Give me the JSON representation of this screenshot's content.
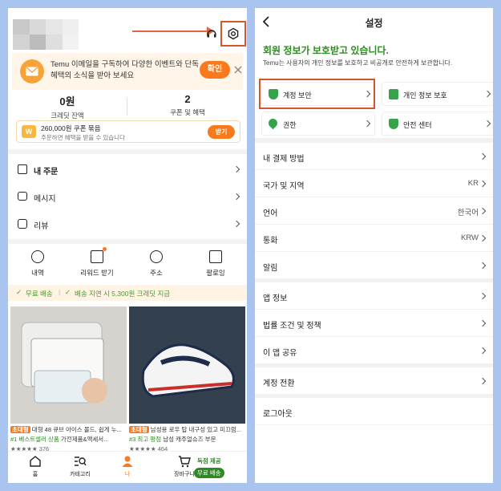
{
  "left": {
    "email_banner": {
      "text": "Temu 이메일을 구독하여 다양한 이벤트와 단독 혜택의 소식을 받아 보세요",
      "button": "확인"
    },
    "stats": [
      {
        "value": "0원",
        "label": "크레딧 잔액"
      },
      {
        "value": "2",
        "label": "쿠폰 및 혜택"
      }
    ],
    "coupon": {
      "title": "260,000원 쿠폰 묶음",
      "subtitle": "주문하면 혜택을 받을 수 있습니다",
      "button": "받기",
      "badge": "W"
    },
    "menu": [
      {
        "label": "내 주문",
        "icon": "orders-icon"
      },
      {
        "label": "메시지",
        "icon": "message-icon"
      },
      {
        "label": "리뷰",
        "icon": "review-icon"
      }
    ],
    "quick_actions": [
      {
        "label": "내역",
        "icon": "history-icon"
      },
      {
        "label": "리워드 받기",
        "icon": "reward-icon"
      },
      {
        "label": "주소",
        "icon": "location-icon"
      },
      {
        "label": "팔로잉",
        "icon": "store-icon"
      }
    ],
    "shipping": {
      "free": "무료 배송",
      "delay": "배송 지연 시 5,300원 크레딧 지급"
    },
    "products": [
      {
        "tag": "초대형",
        "name": "대형 48 큐브 아이스 몰드, 쉽게 누...",
        "rank": "#1 베스트셀러 상품",
        "category": "가전제품&액세서...",
        "count": "376"
      },
      {
        "tag": "초대형",
        "name": "남성용 로우 탑 내구성 있고 미끄럼...",
        "rank": "#3 최고 평점",
        "category": "남성 캐주얼슈즈 부문",
        "count": "464"
      }
    ],
    "tabbar": [
      {
        "label": "홈",
        "icon": "home-icon"
      },
      {
        "label": "카테고리",
        "icon": "category-search-icon"
      },
      {
        "label": "나",
        "icon": "person-icon"
      },
      {
        "label": "장바구니",
        "icon": "cart-icon"
      }
    ],
    "cart_badges": {
      "top": "독점 제공",
      "bottom": "무료 배송"
    }
  },
  "right": {
    "title": "설정",
    "security_heading": "회원 정보가 보호받고 있습니다.",
    "security_sub": "Temu는 사용자의 개인 정보를 보호하고 비공개로 안전하게 보관합니다.",
    "cards": [
      {
        "label": "계정 보안"
      },
      {
        "label": "개인 정보 보호"
      },
      {
        "label": "권한"
      },
      {
        "label": "안전 센터"
      }
    ],
    "group1": [
      {
        "label": "내 결제 방법",
        "value": ""
      },
      {
        "label": "국가 및 지역",
        "value": "KR"
      },
      {
        "label": "언어",
        "value": "한국어"
      },
      {
        "label": "통화",
        "value": "KRW"
      },
      {
        "label": "알림",
        "value": ""
      }
    ],
    "group2": [
      {
        "label": "앱 정보"
      },
      {
        "label": "법률 조건 및 정책"
      },
      {
        "label": "이 앱 공유"
      }
    ],
    "group3": [
      {
        "label": "계정 전환"
      }
    ],
    "group4": [
      {
        "label": "로그아웃"
      }
    ]
  },
  "colors": {
    "accent_orange": "#f97a1c",
    "highlight_red": "#d4572c",
    "security_green": "#2e8a23",
    "background_blue": "#a9c4ee"
  }
}
